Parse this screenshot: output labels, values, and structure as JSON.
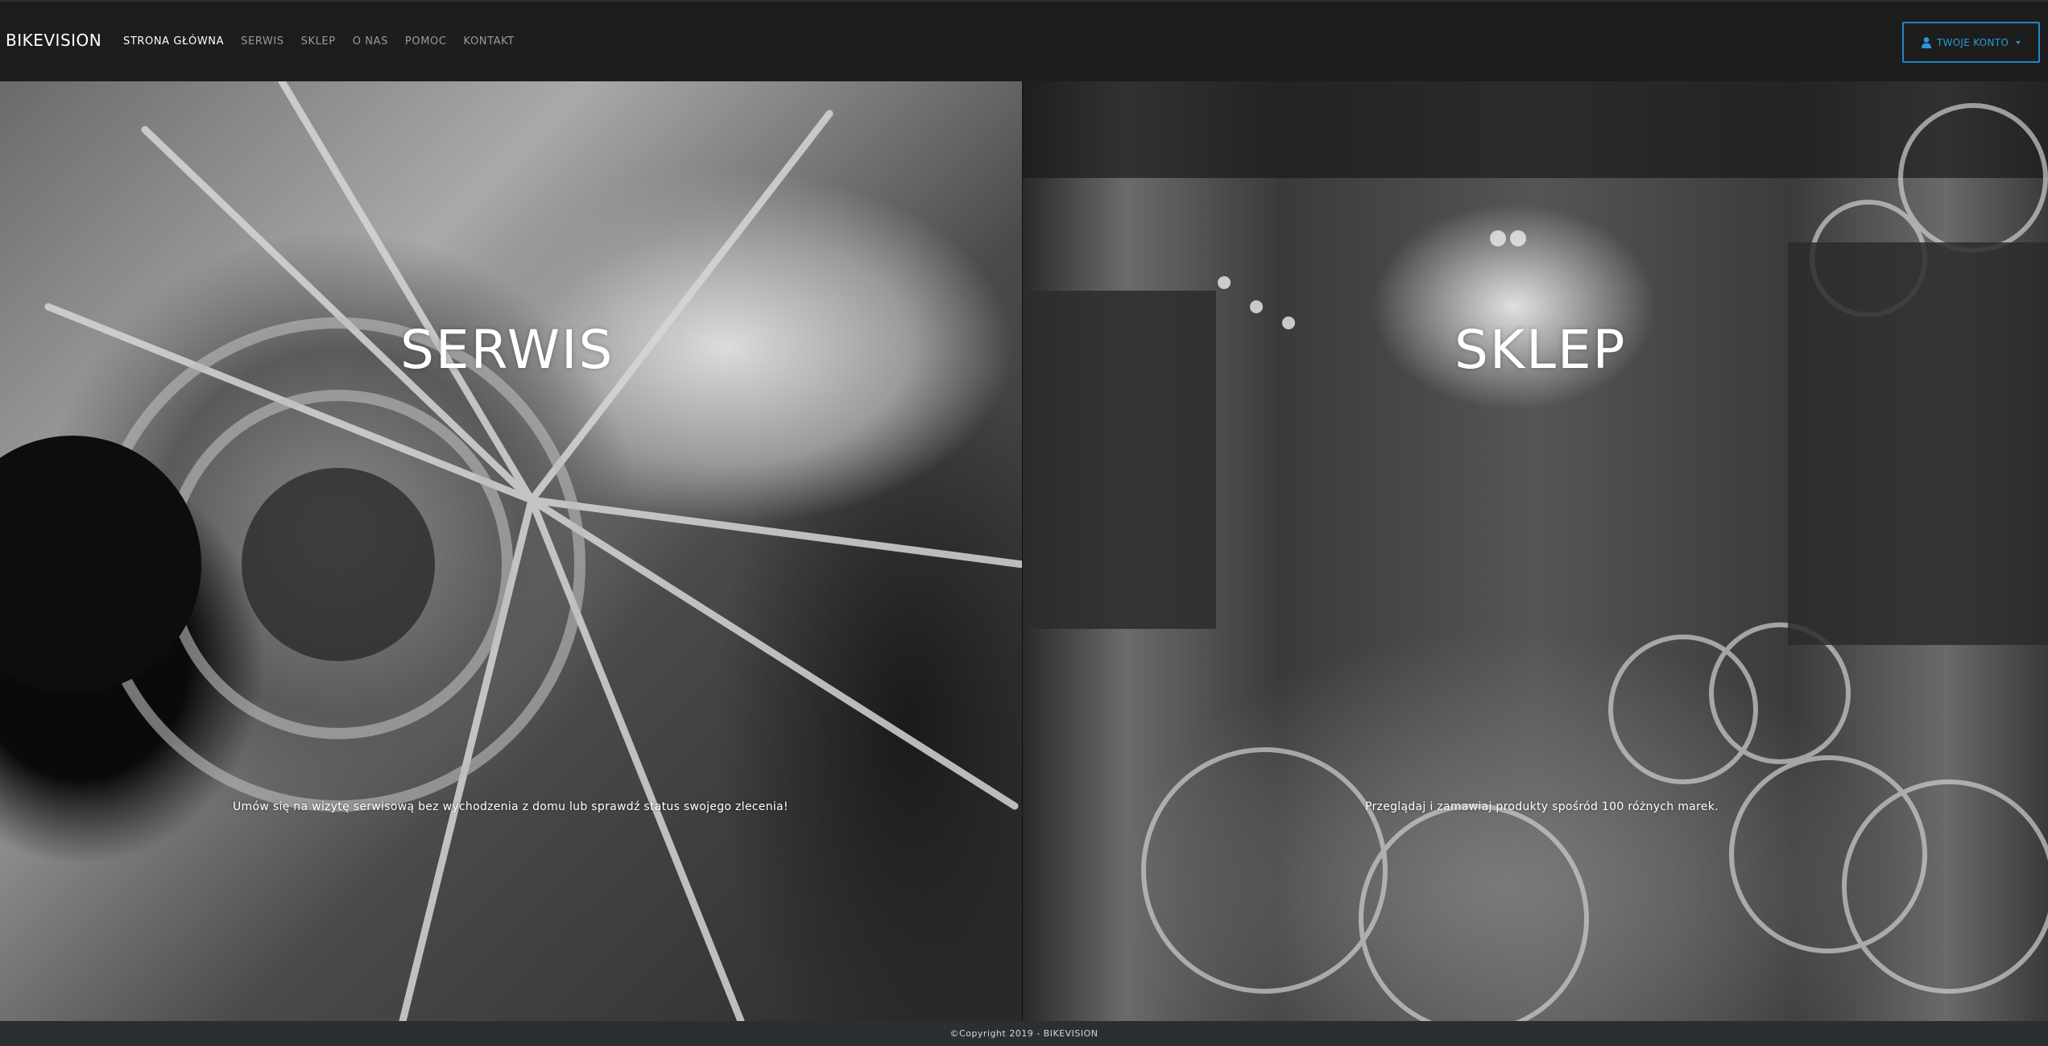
{
  "navbar": {
    "brand": "BIKEVISION",
    "links": [
      {
        "label": "STRONA GŁÓWNA",
        "active": true
      },
      {
        "label": "SERWIS",
        "active": false
      },
      {
        "label": "SKLEP",
        "active": false
      },
      {
        "label": "O NAS",
        "active": false
      },
      {
        "label": "POMOC",
        "active": false
      },
      {
        "label": "KONTAKT",
        "active": false
      }
    ],
    "account_button": {
      "label": "TWOJE KONTO",
      "icon": "user-icon"
    }
  },
  "panels": {
    "service": {
      "title": "SERWIS",
      "text": "Umów się na wizytę serwisową bez wychodzenia z domu lub sprawdź status swojego zlecenia!",
      "image": "bicycle-wheel-hub-photo"
    },
    "shop": {
      "title": "SKLEP",
      "text": "Przeglądaj i zamawiaj produkty spośród 100 różnych marek.",
      "image": "vintage-bicycle-shop-photo"
    }
  },
  "footer": {
    "copyright": "©Copyright 2019 - BIKEVISION"
  },
  "colors": {
    "navbar_bg": "#1d1d1d",
    "accent": "#2a98d8",
    "footer_bg": "#2b2f33"
  }
}
